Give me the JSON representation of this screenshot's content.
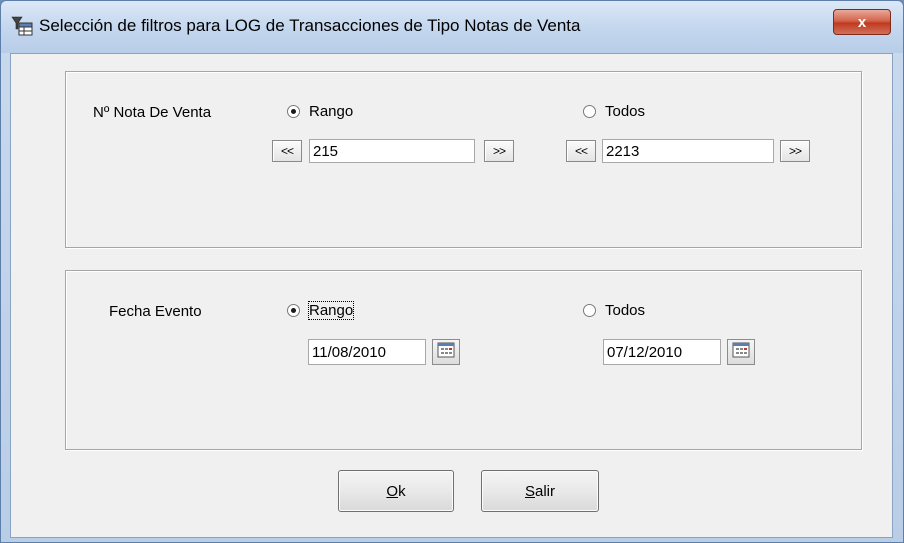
{
  "window": {
    "title": "Selección de filtros para LOG de Transacciones de Tipo Notas de Venta",
    "close_glyph": "x",
    "icon": "filter-table-icon"
  },
  "nota_venta": {
    "label": "Nº Nota De Venta",
    "radio_rango": {
      "label": "Rango",
      "checked": true
    },
    "radio_todos": {
      "label": "Todos",
      "checked": false
    },
    "from": {
      "prev_label": "<<",
      "value": "215",
      "next_label": ">>"
    },
    "to": {
      "prev_label": "<<",
      "value": "2213",
      "next_label": ">>"
    }
  },
  "fecha_evento": {
    "label": "Fecha Evento",
    "radio_rango": {
      "label": "Rango",
      "checked": true
    },
    "radio_todos": {
      "label": "Todos",
      "checked": false
    },
    "from_date": "11/08/2010",
    "to_date": "07/12/2010",
    "calendar_icon": "calendar-icon"
  },
  "buttons": {
    "ok": {
      "accel": "O",
      "rest": "k"
    },
    "salir": {
      "accel": "S",
      "rest": "alir"
    }
  }
}
